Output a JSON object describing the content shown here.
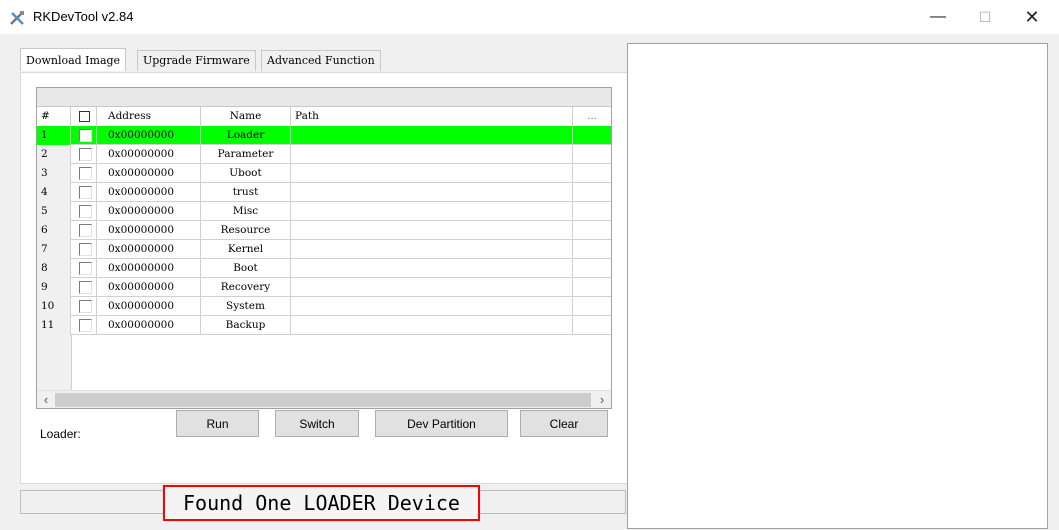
{
  "window": {
    "title": "RKDevTool v2.84",
    "minimize": "—",
    "maximize": "☐",
    "close": "✕"
  },
  "tabs": [
    {
      "label": "Download Image",
      "active": true
    },
    {
      "label": "Upgrade Firmware",
      "active": false
    },
    {
      "label": "Advanced Function",
      "active": false
    }
  ],
  "table": {
    "headers": {
      "num": "#",
      "address": "Address",
      "name": "Name",
      "path": "Path",
      "more": "..."
    },
    "rows": [
      {
        "num": "1",
        "address": "0x00000000",
        "name": "Loader",
        "path": "",
        "checked": false,
        "selected": true
      },
      {
        "num": "2",
        "address": "0x00000000",
        "name": "Parameter",
        "path": "",
        "checked": false
      },
      {
        "num": "3",
        "address": "0x00000000",
        "name": "Uboot",
        "path": "",
        "checked": false
      },
      {
        "num": "4",
        "address": "0x00000000",
        "name": "trust",
        "path": "",
        "checked": false
      },
      {
        "num": "5",
        "address": "0x00000000",
        "name": "Misc",
        "path": "",
        "checked": false
      },
      {
        "num": "6",
        "address": "0x00000000",
        "name": "Resource",
        "path": "",
        "checked": false
      },
      {
        "num": "7",
        "address": "0x00000000",
        "name": "Kernel",
        "path": "",
        "checked": false
      },
      {
        "num": "8",
        "address": "0x00000000",
        "name": "Boot",
        "path": "",
        "checked": false
      },
      {
        "num": "9",
        "address": "0x00000000",
        "name": "Recovery",
        "path": "",
        "checked": false
      },
      {
        "num": "10",
        "address": "0x00000000",
        "name": "System",
        "path": "",
        "checked": false
      },
      {
        "num": "11",
        "address": "0x00000000",
        "name": "Backup",
        "path": "",
        "checked": false
      }
    ],
    "selected_color": "#00ff00"
  },
  "footer": {
    "loader_label": "Loader:"
  },
  "buttons": {
    "run": "Run",
    "switch": "Switch",
    "dev_partition": "Dev Partition",
    "clear": "Clear"
  },
  "status": {
    "message": "Found One LOADER Device",
    "highlight_color": "#ff0000"
  }
}
